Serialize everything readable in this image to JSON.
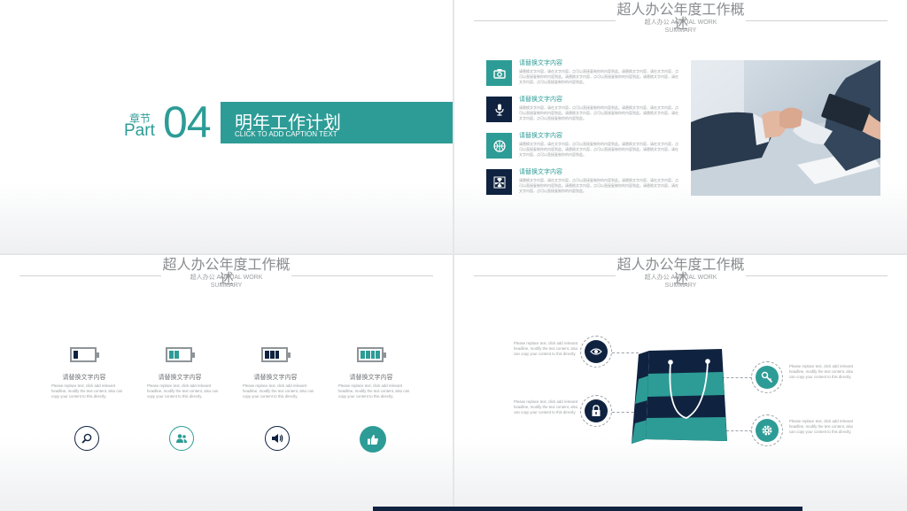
{
  "colors": {
    "teal": "#2d9c96",
    "navy": "#0f2340",
    "gray_text": "#8a8d90"
  },
  "slide1": {
    "chapter_label": "章节",
    "part_label": "Part",
    "part_number": "04",
    "title": "明年工作计划",
    "caption": "CLICK TO ADD CAPTION TEXT"
  },
  "header": {
    "title": "超人办公年度工作概",
    "title_overflow": "述",
    "subtitle_line1": "超人办公 ANNUAL WORK",
    "subtitle_line2": "SUMMARY"
  },
  "slide2": {
    "items": [
      {
        "icon": "camera-icon",
        "title": "请替换文字内容",
        "desc": "请替换文字内容，请在文字内容，点可以直接复制你的内容到此。请替换文字内容，请在文字内容，点可以直接复制你的内容到此。请替换文字内容，点可以直接复制你的内容到此。请替换文字内容，请在文字内容，点可以直接复制你的内容到此。"
      },
      {
        "icon": "microphone-icon",
        "title": "请替换文字内容",
        "desc": "请替换文字内容，请在文字内容，点可以直接复制你的内容到此。请替换文字内容，请在文字内容，点可以直接复制你的内容到此。请替换文字内容，点可以直接复制你的内容到此。请替换文字内容，请在文字内容，点可以直接复制你的内容到此。"
      },
      {
        "icon": "basketball-icon",
        "title": "请替换文字内容",
        "desc": "请替换文字内容，请在文字内容，点可以直接复制你的内容到此。请替换文字内容，请在文字内容，点可以直接复制你的内容到此。请替换文字内容，点可以直接复制你的内容到此。请替换文字内容，请在文字内容，点可以直接复制你的内容到此。"
      },
      {
        "icon": "radiation-icon",
        "title": "请替换文字内容",
        "desc": "请替换文字内容，请在文字内容，点可以直接复制你的内容到此。请替换文字内容，请在文字内容，点可以直接复制你的内容到此。请替换文字内容，点可以直接复制你的内容到此。请替换文字内容，请在文字内容，点可以直接复制你的内容到此。"
      }
    ]
  },
  "slide3": {
    "items": [
      {
        "charge_fraction": 0.25,
        "title": "请替换文字内容",
        "desc": "Please replace text, click add relevant headline, modify the text content, also can copy your content to this directly.",
        "icon": "search-icon"
      },
      {
        "charge_fraction": 0.5,
        "title": "请替换文字内容",
        "desc": "Please replace text, click add relevant headline, modify the text content, also can copy your content to this directly.",
        "icon": "users-icon"
      },
      {
        "charge_fraction": 0.75,
        "title": "请替换文字内容",
        "desc": "Please replace text, click add relevant headline, modify the text content, also can copy your content to this directly.",
        "icon": "speaker-icon"
      },
      {
        "charge_fraction": 1.0,
        "title": "请替换文字内容",
        "desc": "Please replace text, click add relevant headline, modify the text content, also can copy your content to this directly.",
        "icon": "thumbs-up-icon"
      }
    ]
  },
  "slide4": {
    "text": "Please replace text, click add relevant headline, modify the text content, also can copy your content to this directly.",
    "icons": [
      "eye-icon",
      "lock-icon",
      "key-icon",
      "gear-icon"
    ]
  }
}
